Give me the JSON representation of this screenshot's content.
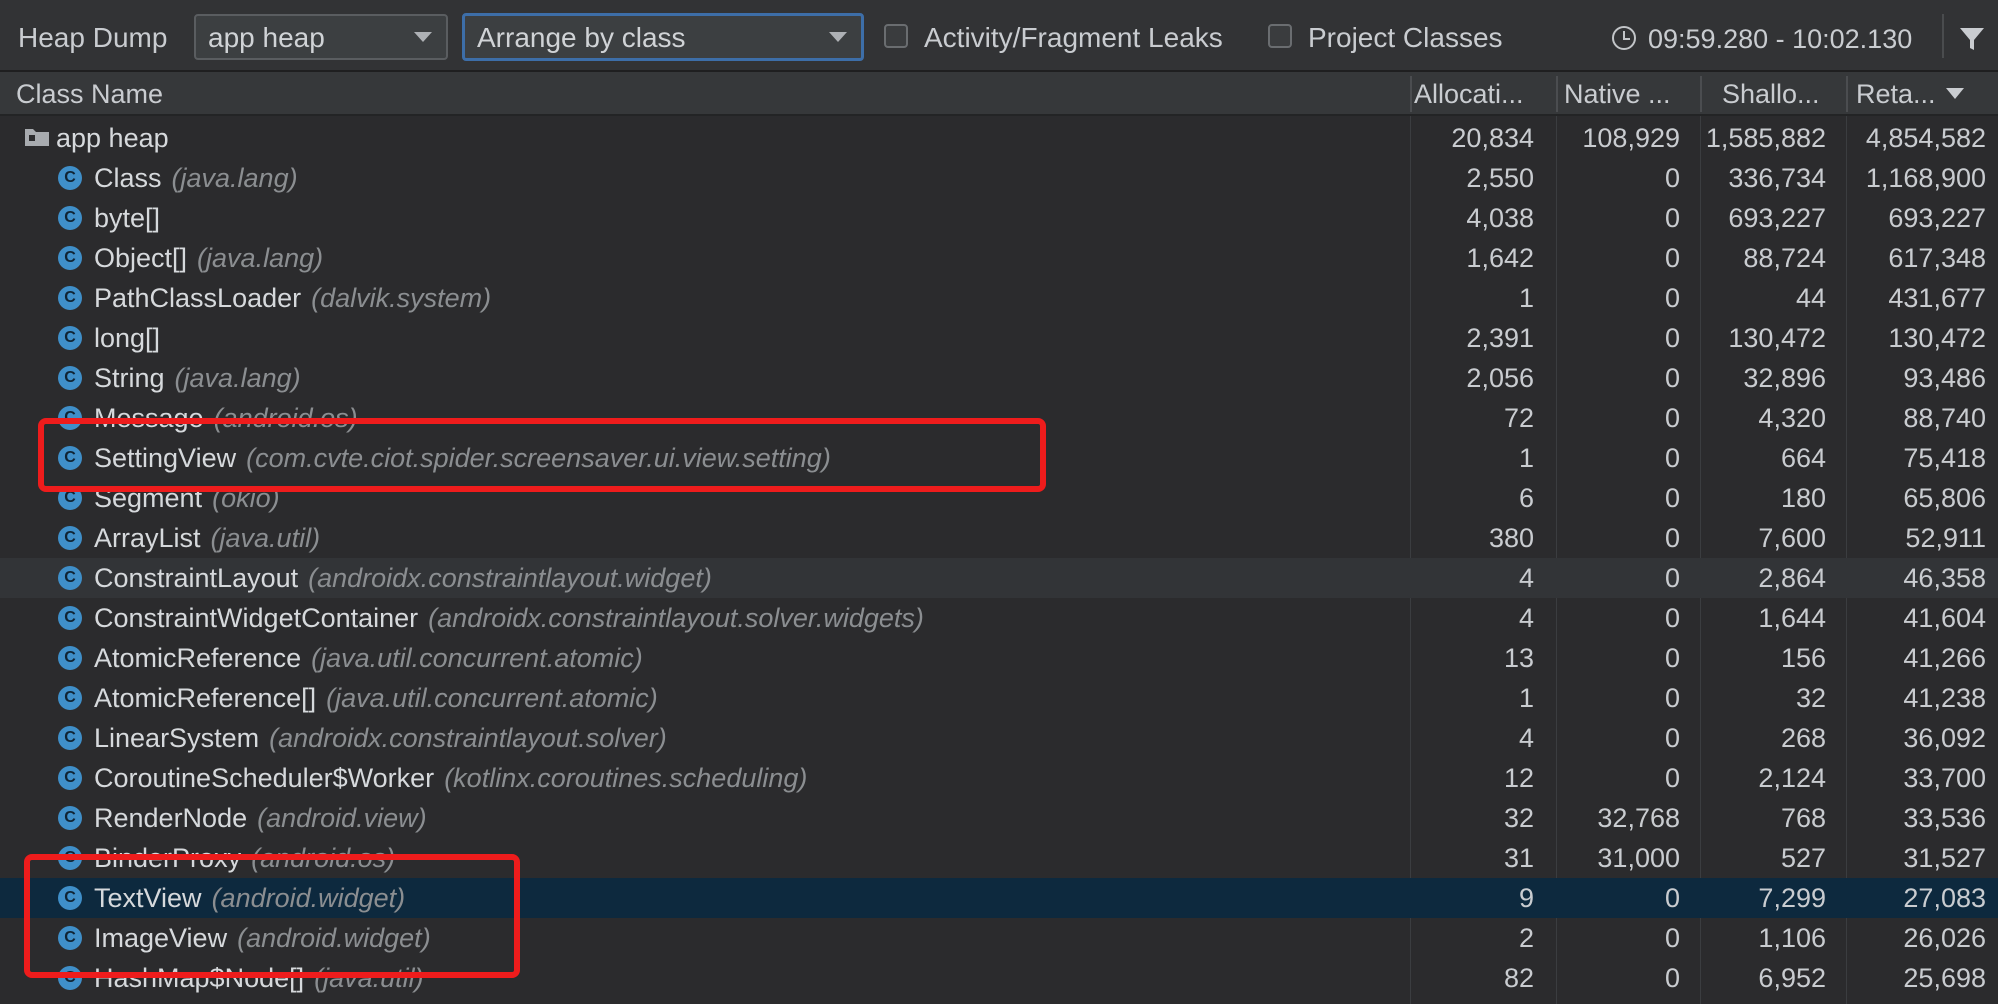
{
  "toolbar": {
    "title": "Heap Dump",
    "heap_select": "app heap",
    "arrange_select": "Arrange by class",
    "leaks_checkbox": "Activity/Fragment Leaks",
    "project_checkbox": "Project Classes",
    "time_range": "09:59.280 - 10:02.130"
  },
  "columns": {
    "name": "Class Name",
    "alloc": "Allocati...",
    "native": "Native ...",
    "shallow": "Shallo...",
    "retained": "Reta..."
  },
  "rows": [
    {
      "name": "app heap",
      "pkg": "",
      "alloc": "20,834",
      "native": "108,929",
      "shallow": "1,585,882",
      "retained": "4,854,582"
    },
    {
      "name": "Class",
      "pkg": "(java.lang)",
      "alloc": "2,550",
      "native": "0",
      "shallow": "336,734",
      "retained": "1,168,900"
    },
    {
      "name": "byte[]",
      "pkg": "",
      "alloc": "4,038",
      "native": "0",
      "shallow": "693,227",
      "retained": "693,227"
    },
    {
      "name": "Object[]",
      "pkg": "(java.lang)",
      "alloc": "1,642",
      "native": "0",
      "shallow": "88,724",
      "retained": "617,348"
    },
    {
      "name": "PathClassLoader",
      "pkg": "(dalvik.system)",
      "alloc": "1",
      "native": "0",
      "shallow": "44",
      "retained": "431,677"
    },
    {
      "name": "long[]",
      "pkg": "",
      "alloc": "2,391",
      "native": "0",
      "shallow": "130,472",
      "retained": "130,472"
    },
    {
      "name": "String",
      "pkg": "(java.lang)",
      "alloc": "2,056",
      "native": "0",
      "shallow": "32,896",
      "retained": "93,486"
    },
    {
      "name": "Message",
      "pkg": "(android.os)",
      "alloc": "72",
      "native": "0",
      "shallow": "4,320",
      "retained": "88,740"
    },
    {
      "name": "SettingView",
      "pkg": "(com.cvte.ciot.spider.screensaver.ui.view.setting)",
      "alloc": "1",
      "native": "0",
      "shallow": "664",
      "retained": "75,418"
    },
    {
      "name": "Segment",
      "pkg": "(okio)",
      "alloc": "6",
      "native": "0",
      "shallow": "180",
      "retained": "65,806"
    },
    {
      "name": "ArrayList",
      "pkg": "(java.util)",
      "alloc": "380",
      "native": "0",
      "shallow": "7,600",
      "retained": "52,911"
    },
    {
      "name": "ConstraintLayout",
      "pkg": "(androidx.constraintlayout.widget)",
      "alloc": "4",
      "native": "0",
      "shallow": "2,864",
      "retained": "46,358"
    },
    {
      "name": "ConstraintWidgetContainer",
      "pkg": "(androidx.constraintlayout.solver.widgets)",
      "alloc": "4",
      "native": "0",
      "shallow": "1,644",
      "retained": "41,604"
    },
    {
      "name": "AtomicReference",
      "pkg": "(java.util.concurrent.atomic)",
      "alloc": "13",
      "native": "0",
      "shallow": "156",
      "retained": "41,266"
    },
    {
      "name": "AtomicReference[]",
      "pkg": "(java.util.concurrent.atomic)",
      "alloc": "1",
      "native": "0",
      "shallow": "32",
      "retained": "41,238"
    },
    {
      "name": "LinearSystem",
      "pkg": "(androidx.constraintlayout.solver)",
      "alloc": "4",
      "native": "0",
      "shallow": "268",
      "retained": "36,092"
    },
    {
      "name": "CoroutineScheduler$Worker",
      "pkg": "(kotlinx.coroutines.scheduling)",
      "alloc": "12",
      "native": "0",
      "shallow": "2,124",
      "retained": "33,700"
    },
    {
      "name": "RenderNode",
      "pkg": "(android.view)",
      "alloc": "32",
      "native": "32,768",
      "shallow": "768",
      "retained": "33,536"
    },
    {
      "name": "BinderProxy",
      "pkg": "(android.os)",
      "alloc": "31",
      "native": "31,000",
      "shallow": "527",
      "retained": "31,527"
    },
    {
      "name": "TextView",
      "pkg": "(android.widget)",
      "alloc": "9",
      "native": "0",
      "shallow": "7,299",
      "retained": "27,083"
    },
    {
      "name": "ImageView",
      "pkg": "(android.widget)",
      "alloc": "2",
      "native": "0",
      "shallow": "1,106",
      "retained": "26,026"
    },
    {
      "name": "HashMap$Node[]",
      "pkg": "(java.util)",
      "alloc": "82",
      "native": "0",
      "shallow": "6,952",
      "retained": "25,698"
    }
  ],
  "icons": {
    "class_icon": "C",
    "root_icon": "folder-icon"
  },
  "colors": {
    "accent": "#3f8fc9",
    "selected_row": "#0d293e",
    "annotation": "#ee1c1c"
  }
}
